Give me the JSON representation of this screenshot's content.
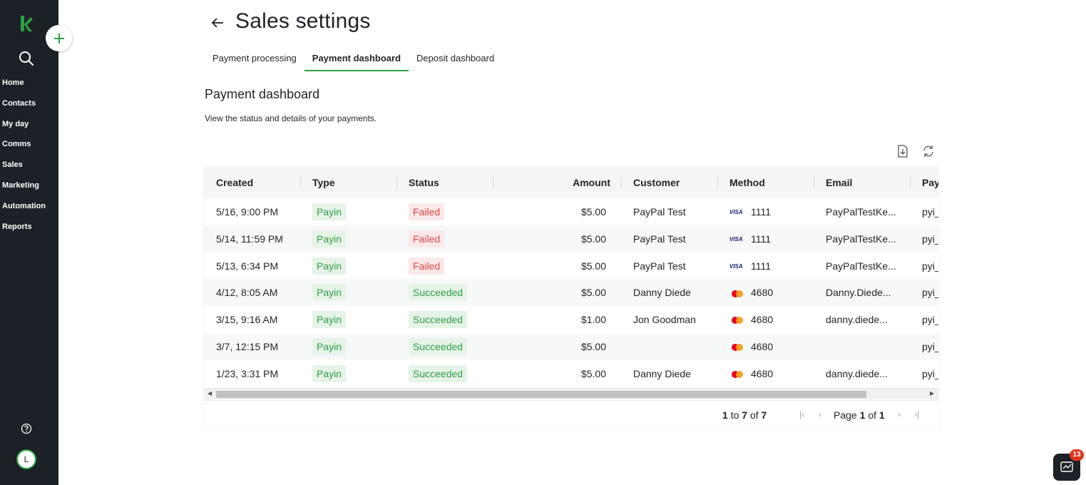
{
  "sidebar": {
    "nav": [
      "Home",
      "Contacts",
      "My day",
      "Comms",
      "Sales",
      "Marketing",
      "Automation",
      "Reports"
    ],
    "avatar_initial": "L",
    "icons": {
      "logo": "keap-logo",
      "search": "search-icon",
      "help": "help-icon"
    },
    "brand_color": "#2e9e45",
    "bg_color": "#1b2126"
  },
  "header": {
    "title": "Sales settings",
    "tabs": [
      "Payment processing",
      "Payment dashboard",
      "Deposit dashboard"
    ],
    "active_tab": "Payment dashboard"
  },
  "section": {
    "title": "Payment dashboard",
    "description": "View the status and details of your payments."
  },
  "table": {
    "columns": [
      "Created",
      "Type",
      "Status",
      "Amount",
      "Customer",
      "Method",
      "Email",
      "Pay"
    ],
    "rows": [
      {
        "created": "5/16, 9:00 PM",
        "type": "Payin",
        "status": "Failed",
        "amount": "$5.00",
        "customer": "PayPal Test",
        "method_brand": "VISA",
        "method_last4": "1111",
        "email": "PayPalTestKe...",
        "pay": "pyi_"
      },
      {
        "created": "5/14, 11:59 PM",
        "type": "Payin",
        "status": "Failed",
        "amount": "$5.00",
        "customer": "PayPal Test",
        "method_brand": "VISA",
        "method_last4": "1111",
        "email": "PayPalTestKe...",
        "pay": "pyi_"
      },
      {
        "created": "5/13, 6:34 PM",
        "type": "Payin",
        "status": "Failed",
        "amount": "$5.00",
        "customer": "PayPal Test",
        "method_brand": "VISA",
        "method_last4": "1111",
        "email": "PayPalTestKe...",
        "pay": "pyi_"
      },
      {
        "created": "4/12, 8:05 AM",
        "type": "Payin",
        "status": "Succeeded",
        "amount": "$5.00",
        "customer": "Danny Diede",
        "method_brand": "mastercard",
        "method_last4": "4680",
        "email": "Danny.Diede...",
        "pay": "pyi_"
      },
      {
        "created": "3/15, 9:16 AM",
        "type": "Payin",
        "status": "Succeeded",
        "amount": "$1.00",
        "customer": "Jon Goodman",
        "method_brand": "mastercard",
        "method_last4": "4680",
        "email": "danny.diede...",
        "pay": "pyi_"
      },
      {
        "created": "3/7, 12:15 PM",
        "type": "Payin",
        "status": "Succeeded",
        "amount": "$5.00",
        "customer": "",
        "method_brand": "mastercard",
        "method_last4": "4680",
        "email": "",
        "pay": "pyi_"
      },
      {
        "created": "1/23, 3:31 PM",
        "type": "Payin",
        "status": "Succeeded",
        "amount": "$5.00",
        "customer": "Danny Diede",
        "method_brand": "mastercard",
        "method_last4": "4680",
        "email": "danny.diede...",
        "pay": "pyi_"
      }
    ]
  },
  "pager": {
    "from": "1",
    "to_word": "to",
    "to": "7",
    "of_word": "of",
    "total": "7",
    "page_word": "Page",
    "page": "1",
    "page_of": "of",
    "pages": "1"
  },
  "chat": {
    "badge": "13"
  }
}
